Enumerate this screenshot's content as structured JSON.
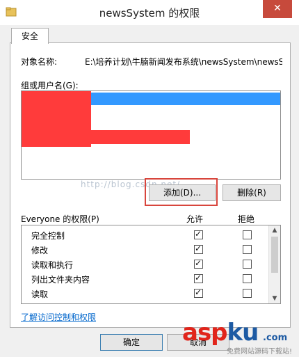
{
  "window": {
    "title": "newsSystem 的权限",
    "close_label": "✕"
  },
  "tabs": [
    {
      "label": "安全"
    }
  ],
  "object": {
    "label": "对象名称:",
    "value": "E:\\培养计划\\牛腩新闻发布系统\\newsSystem\\newsS"
  },
  "groups": {
    "label": "组或用户名(G):"
  },
  "buttons": {
    "add": "添加(D)...",
    "remove": "删除(R)",
    "ok": "确定",
    "cancel": "取消"
  },
  "permissions": {
    "label": "Everyone 的权限(P)",
    "allow_header": "允许",
    "deny_header": "拒绝",
    "rows": [
      {
        "name": "完全控制",
        "allow": true,
        "deny": false
      },
      {
        "name": "修改",
        "allow": true,
        "deny": false
      },
      {
        "name": "读取和执行",
        "allow": true,
        "deny": false
      },
      {
        "name": "列出文件夹内容",
        "allow": true,
        "deny": false
      },
      {
        "name": "读取",
        "allow": true,
        "deny": false
      }
    ]
  },
  "link": {
    "learn_more": "了解访问控制和权限"
  },
  "watermark": {
    "url": "http://blog.csdn.net/",
    "logo_a": "asp",
    "logo_b": "ku",
    "logo_com": ".com",
    "logo_sub": "免费网站源码下载站!"
  }
}
